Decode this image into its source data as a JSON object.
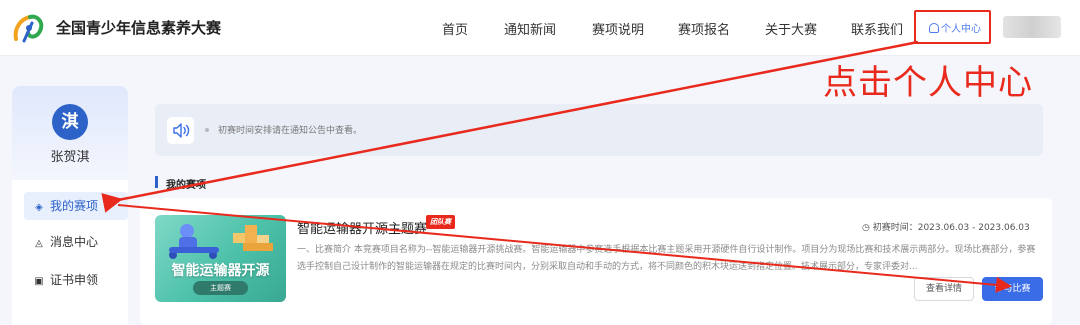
{
  "header": {
    "site_title": "全国青少年信息素养大赛",
    "nav": [
      "首页",
      "通知新闻",
      "赛项说明",
      "赛项报名",
      "关于大赛",
      "联系我们"
    ],
    "user_center": "个人中心"
  },
  "annotation": {
    "text": "点击个人中心",
    "color": "#e8291c"
  },
  "sidebar": {
    "avatar_char": "淇",
    "user_name": "张贺淇",
    "items": [
      {
        "label": "我的赛项",
        "icon": "layers-icon",
        "active": true
      },
      {
        "label": "消息中心",
        "icon": "bell-icon",
        "active": false
      },
      {
        "label": "证书申领",
        "icon": "certificate-icon",
        "active": false
      }
    ]
  },
  "notice": {
    "icon": "speaker-icon",
    "text": "初赛时间安排请在通知公告中查看。"
  },
  "section": {
    "title": "我的赛项"
  },
  "competition": {
    "thumb_title": "智能运输器开源",
    "thumb_badge": "主题赛",
    "title": "智能运输器开源主题赛",
    "tag": "团队赛",
    "time_label": "初赛时间：2023.06.03 - 2023.06.03",
    "description": "一、比赛简介 本竞赛项目名称为--智能运输器开源挑战赛。智能运输器中参赛选手根据本比赛主题采用开源硬件自行设计制作。项目分为现场比赛和技术展示两部分。现场比赛部分，参赛选手控制自己设计制作的智能运输器在规定的比赛时间内，分别采取自动和手动的方式，将不同颜色的积木块运送到指定位置。技术展示部分，专家评委对...",
    "detail_button": "查看详情",
    "join_button": "参与比赛"
  },
  "colors": {
    "accent": "#3b6ce8",
    "brand": "#2d62c9",
    "annotation_red": "#e8291c"
  }
}
